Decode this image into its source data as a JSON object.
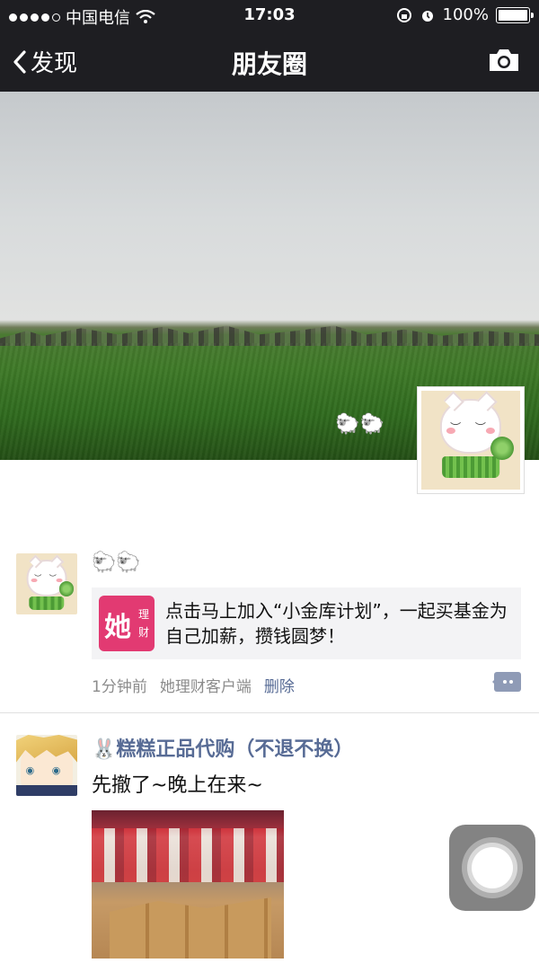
{
  "status_bar": {
    "carrier": "中国电信",
    "time": "17:03",
    "battery": "100%",
    "battery_level": 1.0
  },
  "nav": {
    "back_label": "发现",
    "title": "朋友圈",
    "camera_icon": "camera-icon"
  },
  "cover": {
    "nickname": "🐑🐑"
  },
  "posts": [
    {
      "name": "🐑🐑",
      "share_icon_big": "她",
      "share_icon_small_1": "理",
      "share_icon_small_2": "财",
      "share_text": "点击马上加入“小金库计划”，一起买基金为自己加薪，攒钱圆梦！",
      "time": "1分钟前",
      "source": "她理财客户端",
      "delete_label": "删除"
    },
    {
      "name": "🐰糕糕正品代购（不退不换）",
      "text": "先撤了~晚上在来~"
    }
  ],
  "colors": {
    "nav_bg": "#1e1e22",
    "link": "#576b95",
    "meta": "#8c8c8c",
    "share_bg": "#f3f3f5",
    "brand_pink": "#e23a72"
  }
}
